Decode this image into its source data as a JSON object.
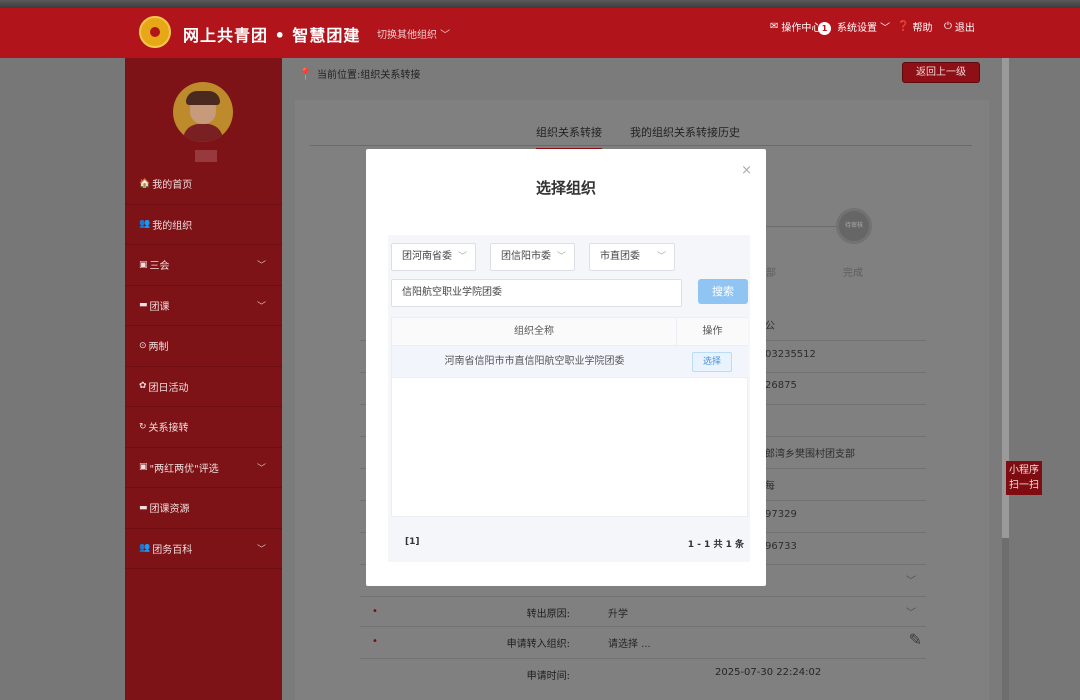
{
  "header": {
    "brand": "网上共青团 • 智慧团建",
    "switch_org": "切换其他组织 ﹀",
    "ops_center": "操作中心",
    "badge": "1",
    "settings": "系统设置 ﹀",
    "help": "帮助",
    "logout": "退出"
  },
  "breadcrumb": {
    "text": "当前位置:组织关系转接",
    "back": "返回上一级"
  },
  "sidebar": {
    "items": [
      {
        "icon": "🏠",
        "label": "我的首页",
        "chev": ""
      },
      {
        "icon": "👥",
        "label": "我的组织",
        "chev": ""
      },
      {
        "icon": "▣",
        "label": "三会",
        "chev": "﹀"
      },
      {
        "icon": "▬",
        "label": "团课",
        "chev": "﹀"
      },
      {
        "icon": "⊙",
        "label": "两制",
        "chev": ""
      },
      {
        "icon": "✿",
        "label": "团日活动",
        "chev": ""
      },
      {
        "icon": "↻",
        "label": "关系接转",
        "chev": ""
      },
      {
        "icon": "▣",
        "label": "\"两红两优\"评选",
        "chev": "﹀"
      },
      {
        "icon": "▬",
        "label": "团课资源",
        "chev": ""
      },
      {
        "icon": "👥",
        "label": "团务百科",
        "chev": "﹀"
      }
    ]
  },
  "tabs": {
    "transfer": "组织关系转接",
    "history": "我的组织关系转接历史"
  },
  "steps": {
    "circle": "待审核",
    "label_left": "部",
    "label_done": "完成"
  },
  "bg_rows": [
    "公",
    "03235512",
    "26875",
    "",
    "郎湾乡樊围村团支部",
    "每",
    "97329",
    "96733"
  ],
  "form": {
    "reason_label": "转出原因:",
    "reason_value": "升学",
    "target_label": "申请转入组织:",
    "target_value": "请选择 ...",
    "time_label": "申请时间:",
    "time_value": "2025-07-30 22:24:02",
    "required": "•"
  },
  "mini_program": {
    "line1": "小程序",
    "line2": "扫一扫"
  },
  "modal": {
    "title": "选择组织",
    "close": "×",
    "selects": [
      "团河南省委",
      "团信阳市委",
      "市直团委"
    ],
    "search_value": "信阳航空职业学院团委",
    "search_button": "搜索",
    "table": {
      "col_name": "组织全称",
      "col_action": "操作",
      "rows": [
        {
          "name": "河南省信阳市市直信阳航空职业学院团委",
          "action": "选择"
        }
      ]
    },
    "pager_left": "[1]",
    "pager_right": "1 - 1   共 1 条"
  }
}
